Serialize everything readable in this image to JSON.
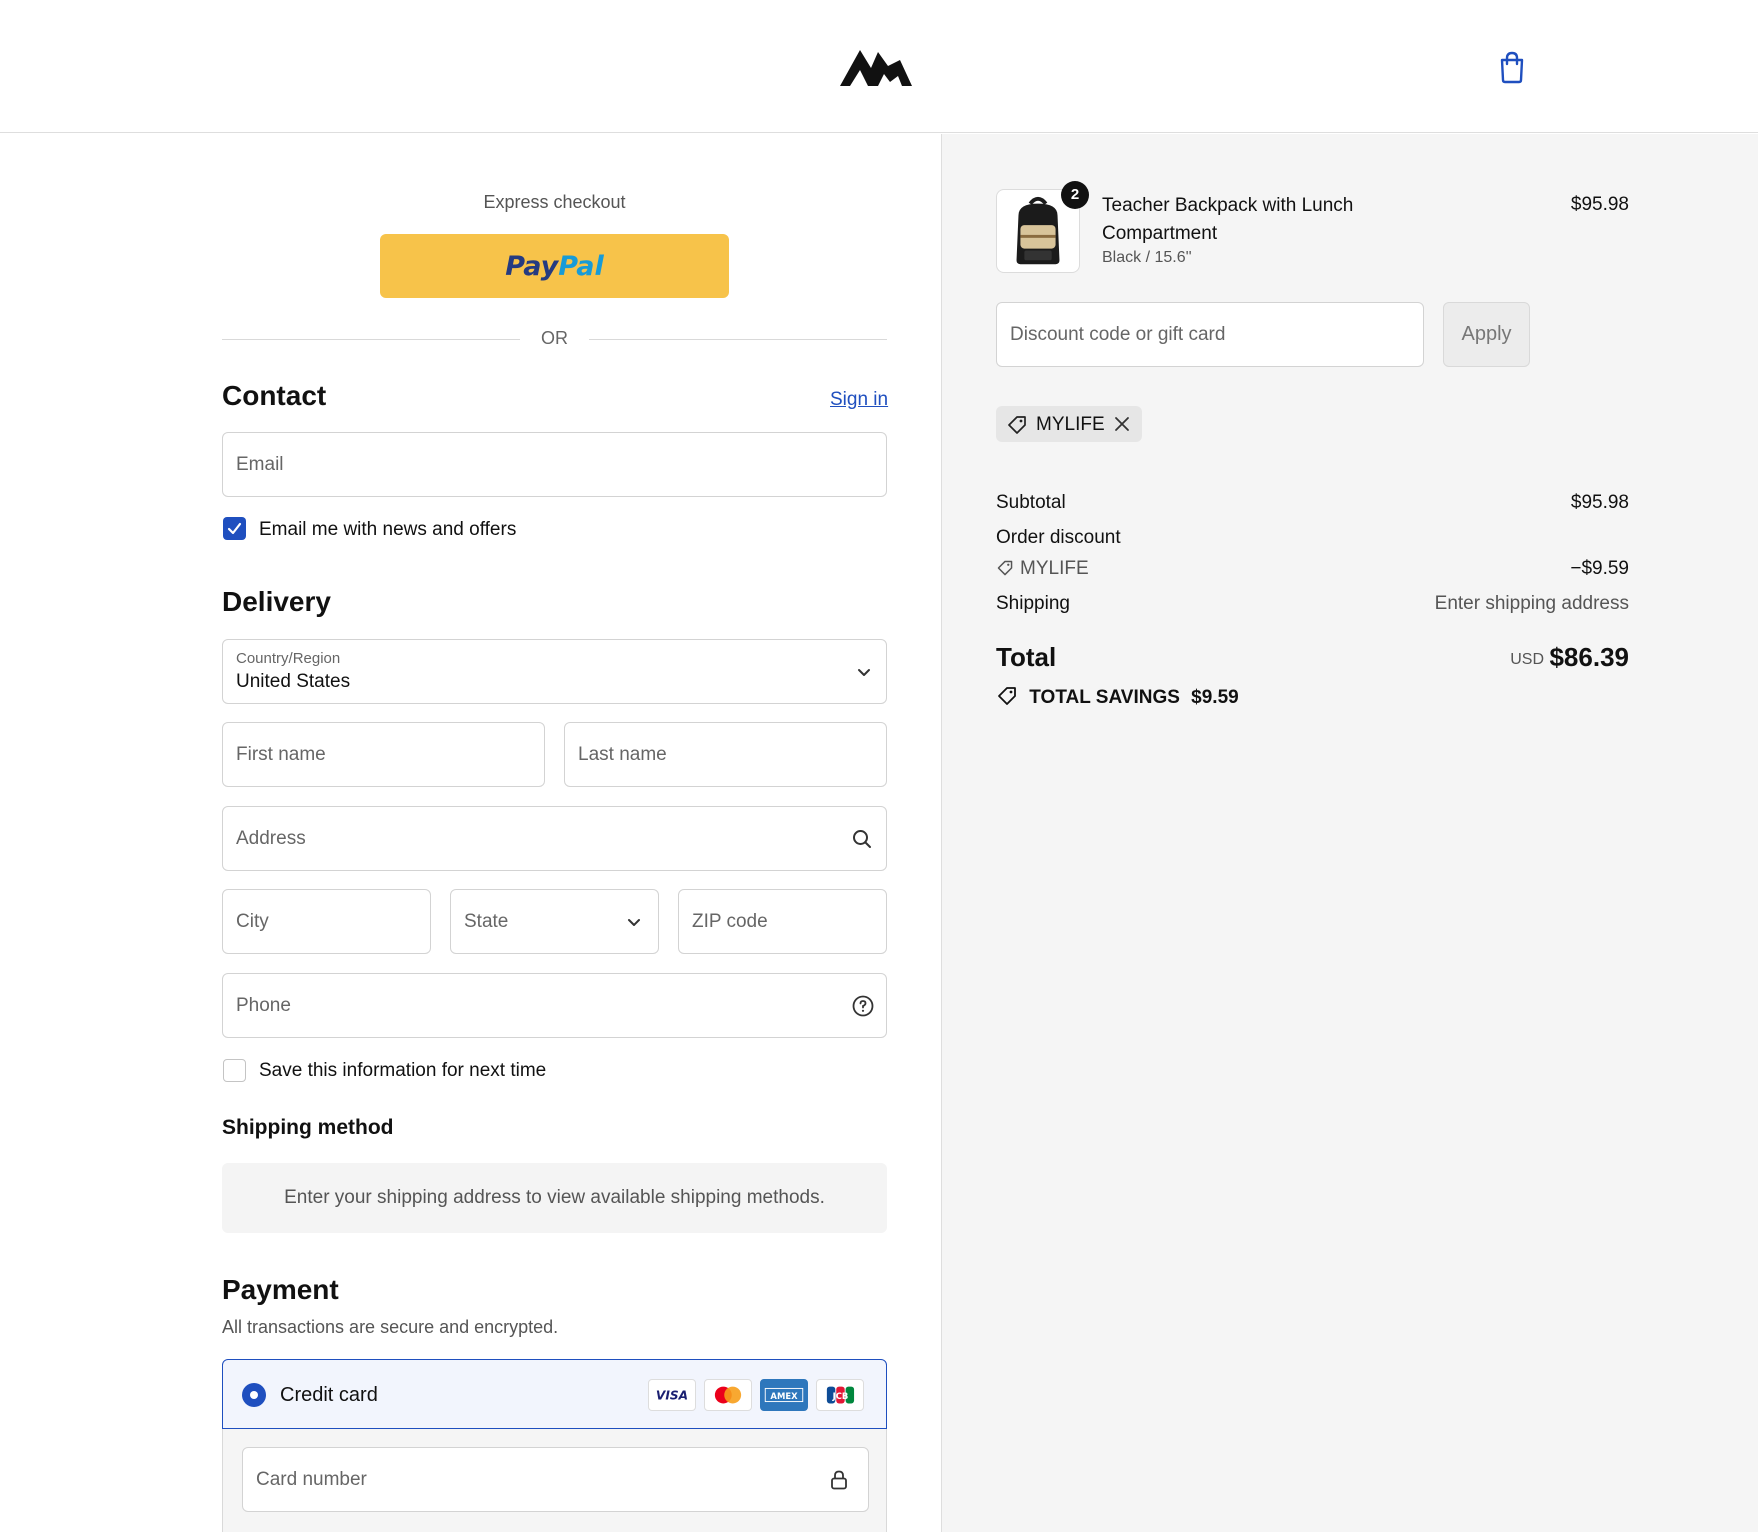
{
  "header": {
    "logo": "mountain-logo",
    "cart_icon": "shopping-bag-icon"
  },
  "express": {
    "label": "Express checkout",
    "paypal_part1": "Pay",
    "paypal_part2": "Pal",
    "divider": "OR"
  },
  "contact": {
    "title": "Contact",
    "sign_in": "Sign in",
    "email_placeholder": "Email",
    "news_label": "Email me with news and offers",
    "news_checked": true
  },
  "delivery": {
    "title": "Delivery",
    "country_label": "Country/Region",
    "country_value": "United States",
    "first_name_placeholder": "First name",
    "last_name_placeholder": "Last name",
    "address_placeholder": "Address",
    "city_placeholder": "City",
    "state_placeholder": "State",
    "zip_placeholder": "ZIP code",
    "phone_placeholder": "Phone",
    "save_label": "Save this information for next time",
    "save_checked": false
  },
  "shipping_method": {
    "title": "Shipping method",
    "message": "Enter your shipping address to view available shipping methods."
  },
  "payment": {
    "title": "Payment",
    "subtitle": "All transactions are secure and encrypted.",
    "credit_card_label": "Credit card",
    "card_brands": [
      "VISA",
      "Mastercard",
      "AMEX",
      "JCB"
    ],
    "card_number_placeholder": "Card number"
  },
  "summary": {
    "product": {
      "name": "Teacher Backpack with Lunch Compartment",
      "variant": "Black / 15.6''",
      "quantity": "2",
      "price": "$95.98"
    },
    "discount_placeholder": "Discount code or gift card",
    "apply_label": "Apply",
    "applied_code": "MYLIFE",
    "subtotal_label": "Subtotal",
    "subtotal_value": "$95.98",
    "order_discount_label": "Order discount",
    "discount_code": "MYLIFE",
    "discount_value": "−$9.59",
    "shipping_label": "Shipping",
    "shipping_value": "Enter shipping address",
    "total_label": "Total",
    "currency": "USD",
    "total_value": "$86.39",
    "savings_label": "TOTAL SAVINGS",
    "savings_value": "$9.59"
  },
  "colors": {
    "accent": "#1f4fbf",
    "paypal_yellow": "#f7c34a",
    "sidebar_bg": "#f5f5f5"
  }
}
